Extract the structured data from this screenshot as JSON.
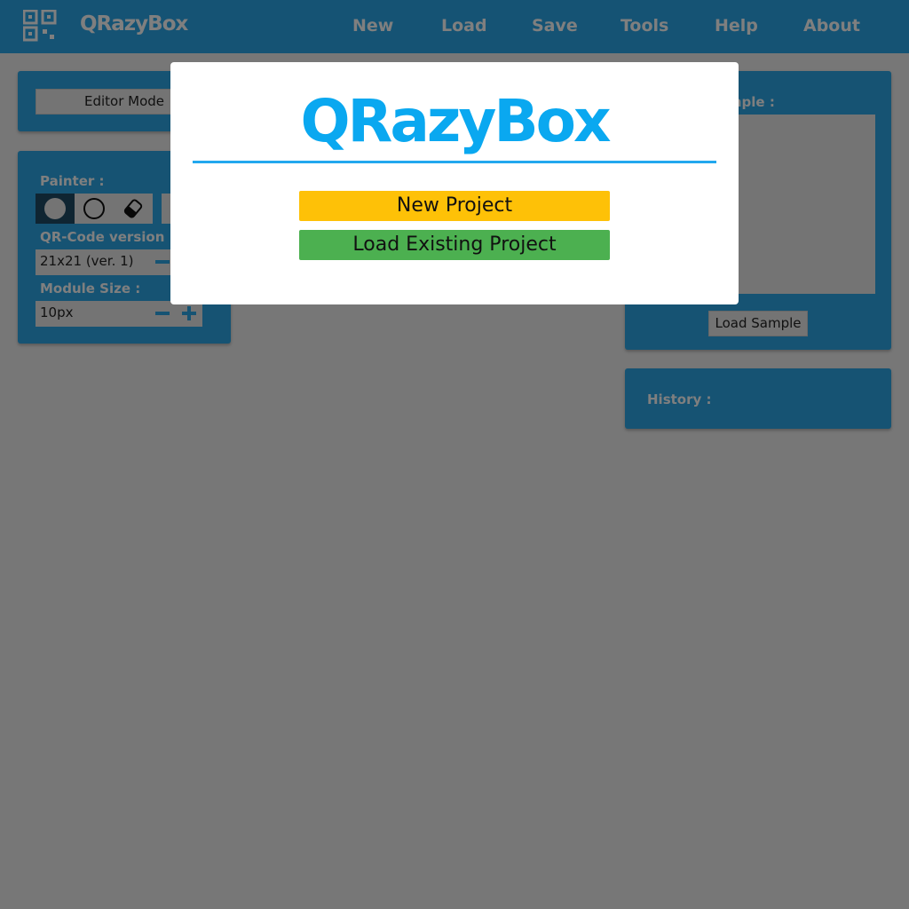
{
  "nav": {
    "brand": "QRazyBox",
    "items": [
      "New",
      "Load",
      "Save",
      "Tools",
      "Help",
      "About"
    ]
  },
  "left_panel": {
    "editor_mode_label": "Editor Mode",
    "painter_label": "Painter :",
    "version_label": "QR-Code version :",
    "version_value": "21x21 (ver. 1)",
    "module_size_label": "Module Size :",
    "module_size_value": "10px"
  },
  "right_panel": {
    "sample_label": "Sample :",
    "load_sample_label": "Load Sample",
    "history_label": "History :"
  },
  "dialog": {
    "logo_text": "QRazyBox",
    "new_project_label": "New Project",
    "load_project_label": "Load Existing Project"
  },
  "colors": {
    "brand_blue": "#2aa7e8",
    "new_button": "#fec107",
    "load_button": "#4cb050"
  }
}
